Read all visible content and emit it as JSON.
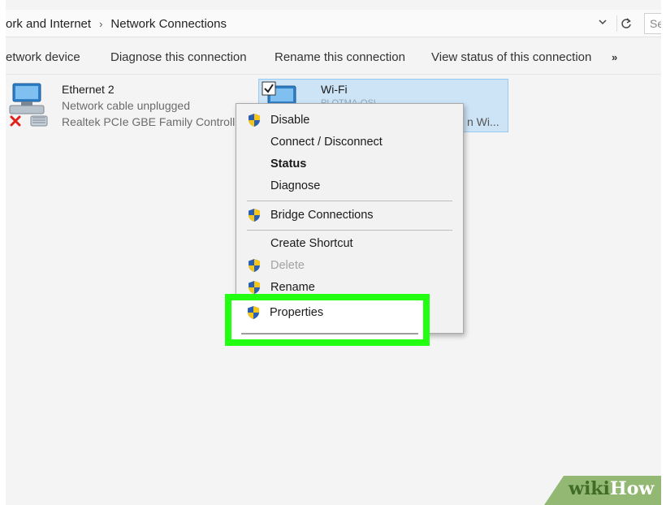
{
  "address": {
    "crumbs": [
      "ork and Internet",
      "Network Connections"
    ],
    "separator": "›",
    "dropdown_icon": "chevron-down-icon",
    "refresh_icon": "refresh-icon",
    "search_placeholder": "Se"
  },
  "commands": {
    "items": [
      "etwork device",
      "Diagnose this connection",
      "Rename this connection",
      "View status of this connection"
    ],
    "more": "»"
  },
  "connections": {
    "ethernet": {
      "name": "Ethernet 2",
      "status": "Network cable unplugged",
      "adapter": "Realtek PCIe GBE Family Controll"
    },
    "wifi": {
      "name": "Wi-Fi",
      "ssid_partial": "PLOTMA-OSL",
      "adapter_partial": "n Wi..."
    }
  },
  "context_menu": {
    "disable": "Disable",
    "connect_disconnect": "Connect / Disconnect",
    "status": "Status",
    "diagnose": "Diagnose",
    "bridge": "Bridge Connections",
    "create_shortcut": "Create Shortcut",
    "delete": "Delete",
    "rename": "Rename",
    "properties": "Properties"
  },
  "watermark": {
    "wiki": "wiki",
    "how": "How"
  },
  "colors": {
    "highlight": "#22ff11",
    "selection": "#cde4f7",
    "watermark_green": "#3f6d27"
  }
}
